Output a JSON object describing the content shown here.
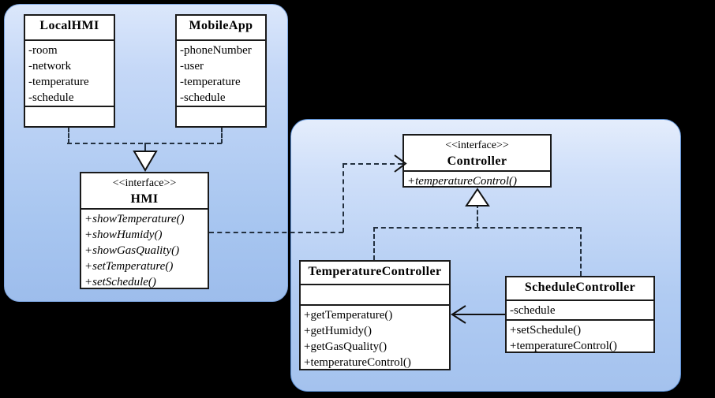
{
  "diagram": {
    "title": "Smart Home UML Class Diagram",
    "type": "uml-class-diagram",
    "background": "#000000"
  },
  "packages": [
    {
      "id": "client",
      "name": "client-package",
      "fill_top": "#dbe7fb",
      "fill_bottom": "#9dbdec"
    },
    {
      "id": "server",
      "name": "server-package",
      "fill_top": "#e4edfc",
      "fill_bottom": "#a4c2ee"
    }
  ],
  "classes": {
    "local_hmi": {
      "name": "LocalHMI",
      "stereotype": "",
      "attributes": [
        "-room",
        "-network",
        "-temperature",
        "-schedule"
      ],
      "operations": []
    },
    "mobile_app": {
      "name": "MobileApp",
      "stereotype": "",
      "attributes": [
        "-phoneNumber",
        "-user",
        "-temperature",
        "-schedule"
      ],
      "operations": []
    },
    "hmi": {
      "name": "HMI",
      "stereotype": "<<interface>>",
      "attributes": [],
      "operations": [
        "+showTemperature()",
        "+showHumidy()",
        "+showGasQuality()",
        "+setTemperature()",
        "+setSchedule()"
      ]
    },
    "controller": {
      "name": "Controller",
      "stereotype": "<<interface>>",
      "attributes": [],
      "operations": [
        "+temperatureControl()"
      ]
    },
    "temperature_controller": {
      "name": "TemperatureController",
      "stereotype": "",
      "attributes": [],
      "operations": [
        "+getTemperature()",
        "+getHumidy()",
        "+getGasQuality()",
        "+temperatureControl()"
      ]
    },
    "schedule_controller": {
      "name": "ScheduleController",
      "stereotype": "",
      "attributes": [
        "-schedule"
      ],
      "operations": [
        "+setSchedule()",
        "+temperatureControl()"
      ]
    }
  },
  "relationships": [
    {
      "id": "localhmi-realizes-hmi",
      "kind": "realization",
      "from": "LocalHMI",
      "to": "HMI",
      "line": "dashed",
      "head": "hollow-triangle"
    },
    {
      "id": "mobileapp-realizes-hmi",
      "kind": "realization",
      "from": "MobileApp",
      "to": "HMI",
      "line": "dashed",
      "head": "hollow-triangle"
    },
    {
      "id": "hmi-depends-controller",
      "kind": "dependency",
      "from": "HMI",
      "to": "Controller",
      "line": "dashed",
      "head": "open-arrow"
    },
    {
      "id": "temperaturecontroller-realizes-controller",
      "kind": "realization",
      "from": "TemperatureController",
      "to": "Controller",
      "line": "dashed",
      "head": "hollow-triangle"
    },
    {
      "id": "schedulecontroller-realizes-controller",
      "kind": "realization",
      "from": "ScheduleController",
      "to": "Controller",
      "line": "dashed",
      "head": "hollow-triangle"
    },
    {
      "id": "schedulecontroller-assoc-temperaturecontroller",
      "kind": "association",
      "from": "ScheduleController",
      "to": "TemperatureController",
      "line": "solid",
      "head": "open-arrow"
    }
  ]
}
